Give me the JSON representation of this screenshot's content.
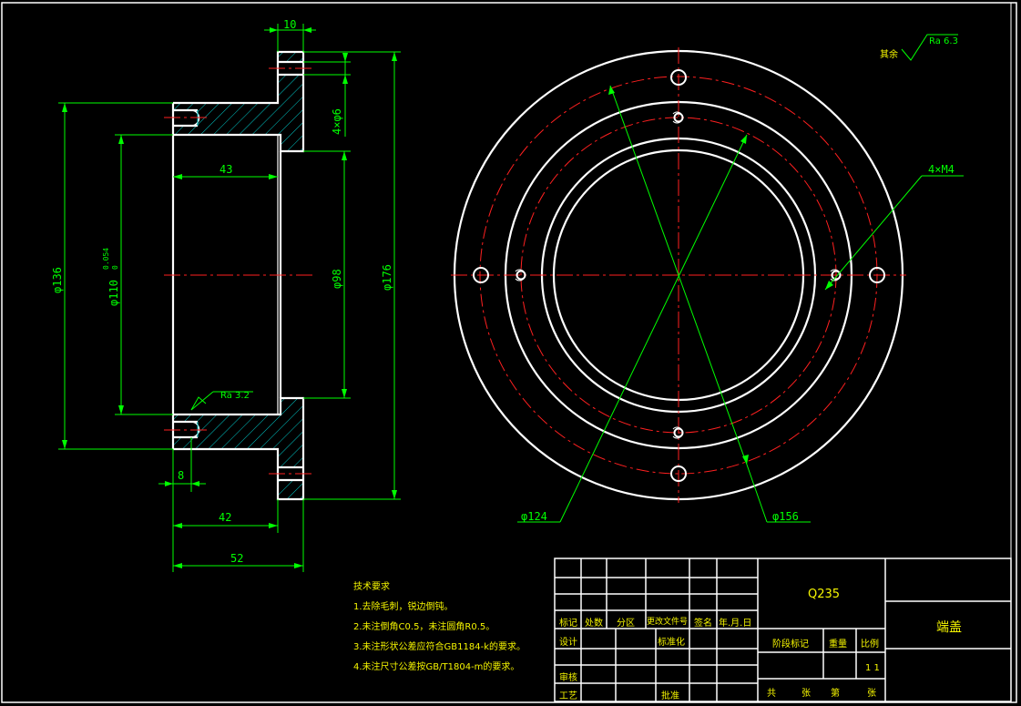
{
  "colors": {
    "background": "#000000",
    "outline": "#ffffff",
    "dimension": "#00ff00",
    "centerline": "#ff2020",
    "hatch": "#00c8c8",
    "text": "#f5f500"
  },
  "dimensions": {
    "d10": "10",
    "d4x6": "4×φ6",
    "d136": "φ136",
    "d110": "φ110",
    "d110_tol_upper": "0.054",
    "d110_tol_lower": "0",
    "d43": "43",
    "d98": "φ98",
    "d176": "φ176",
    "d8": "8",
    "d42": "42",
    "d52": "52",
    "d124": "φ124",
    "d156": "φ156",
    "d4xm4": "4×M4"
  },
  "roughness": {
    "other": "其余",
    "ra63": "Ra 6.3",
    "ra32": "Ra 3.2"
  },
  "notes": {
    "title": "技术要求",
    "line1": "1.去除毛刺，锐边倒钝。",
    "line2": "2.未注倒角C0.5，未注圆角R0.5。",
    "line3": "3.未注形状公差应符合GB1184-k的要求。",
    "line4": "4.未注尺寸公差按GB/T1804-m的要求。"
  },
  "title_block": {
    "material": "Q235",
    "part_name": "端盖",
    "mark": "标记",
    "count": "处数",
    "zone": "分区",
    "change_doc": "更改文件号",
    "sign": "签名",
    "date": "年.月.日",
    "design": "设计",
    "standardize": "标准化",
    "check": "审核",
    "process": "工艺",
    "approve": "批准",
    "stage_mark": "阶段标记",
    "weight": "重量",
    "scale": "比例",
    "scale_value": "1 1",
    "total": "共",
    "sheets": "张",
    "page_no": "第",
    "sheet": "张"
  }
}
